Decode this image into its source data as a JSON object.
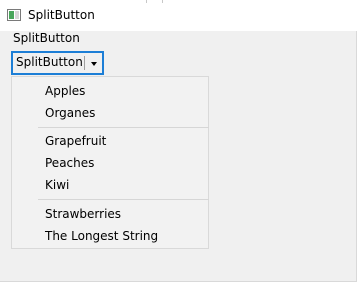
{
  "window": {
    "title": "SplitButton"
  },
  "section": {
    "label": "SplitButton"
  },
  "split_button": {
    "label": "SplitButton"
  },
  "menu": {
    "items": [
      "Apples",
      "Organes",
      "Grapefruit",
      "Peaches",
      "Kiwi",
      "Strawberries",
      "The Longest String"
    ]
  }
}
